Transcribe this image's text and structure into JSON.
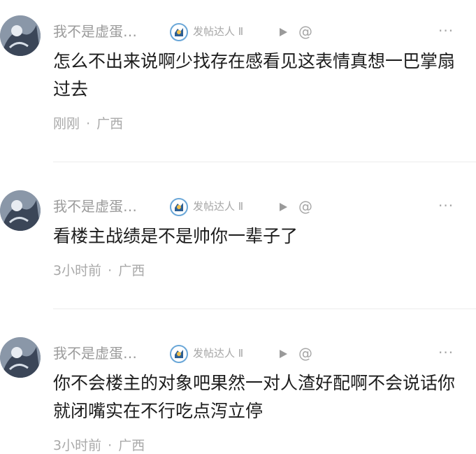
{
  "comments": [
    {
      "username": "我不是虚蛋…",
      "badge": "发帖达人 Ⅱ",
      "content": "怎么不出来说啊少找存在感看见这表情真想一巴掌扇过去",
      "time": "刚刚",
      "location": "广西"
    },
    {
      "username": "我不是虚蛋…",
      "badge": "发帖达人 Ⅱ",
      "content": "看楼主战绩是不是帅你一辈子了",
      "time": "3小时前",
      "location": "广西"
    },
    {
      "username": "我不是虚蛋…",
      "badge": "发帖达人 Ⅱ",
      "content": "你不会楼主的对象吧果然一对人渣好配啊不会说话你就闭嘴实在不行吃点泻立停",
      "time": "3小时前",
      "location": "广西"
    }
  ],
  "icons": {
    "play": "play-icon",
    "at": "at-icon",
    "more": "more-icon",
    "badge": "badge-icon"
  },
  "text": {
    "at_symbol": "@",
    "more_symbol": "···",
    "separator": "·"
  }
}
